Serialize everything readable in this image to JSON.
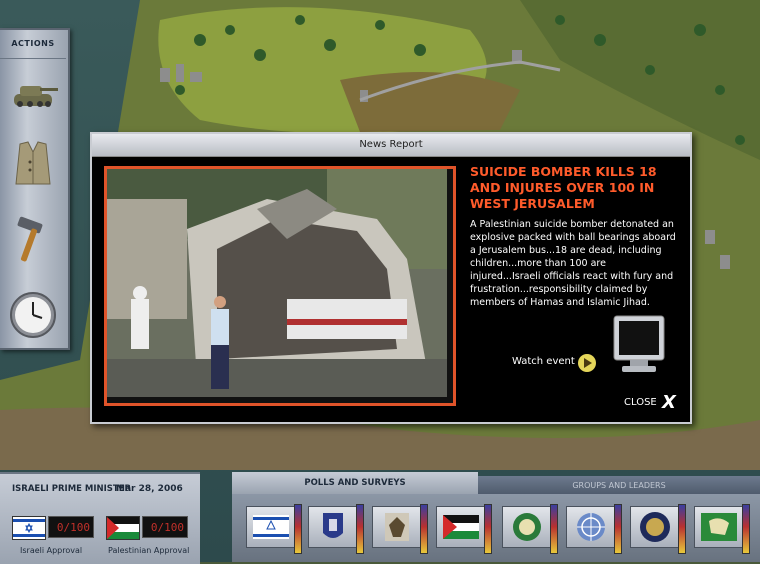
{
  "actions": {
    "title": "ACTIONS",
    "items": [
      {
        "icon": "tank-icon"
      },
      {
        "icon": "vest-icon"
      },
      {
        "icon": "hammer-icon"
      },
      {
        "icon": "clock-icon"
      }
    ]
  },
  "news": {
    "window_title": "News Report",
    "headline": "SUICIDE BOMBER KILLS 18 AND INJURES OVER 100 IN WEST JERUSALEM",
    "body": "A Palestinian suicide bomber detonated an explosive packed with ball bearings aboard a Jerusalem bus...18 are dead, including children...more than 100 are injured...Israeli officials react with fury and frustration...responsibility claimed by members of Hamas and Islamic Jihad.",
    "watch_label": "Watch event",
    "close_label": "CLOSE",
    "close_glyph": "X"
  },
  "status": {
    "role": "ISRAELI PRIME MINISTER",
    "date": "Mar 28, 2006",
    "israeli_approval": {
      "value": "0/100",
      "label": "Israeli Approval"
    },
    "palestinian_approval": {
      "value": "0/100",
      "label": "Palestinian Approval"
    }
  },
  "tabs": {
    "polls": "POLLS AND SURVEYS",
    "groups": "GROUPS AND LEADERS"
  },
  "groups": [
    {
      "icon": "israel-flag-icon"
    },
    {
      "icon": "emblem-icon"
    },
    {
      "icon": "palestinian-eagle-icon"
    },
    {
      "icon": "palestine-flag-icon"
    },
    {
      "icon": "hamas-emblem-icon"
    },
    {
      "icon": "un-emblem-icon"
    },
    {
      "icon": "us-seal-icon"
    },
    {
      "icon": "arab-league-icon"
    }
  ]
}
